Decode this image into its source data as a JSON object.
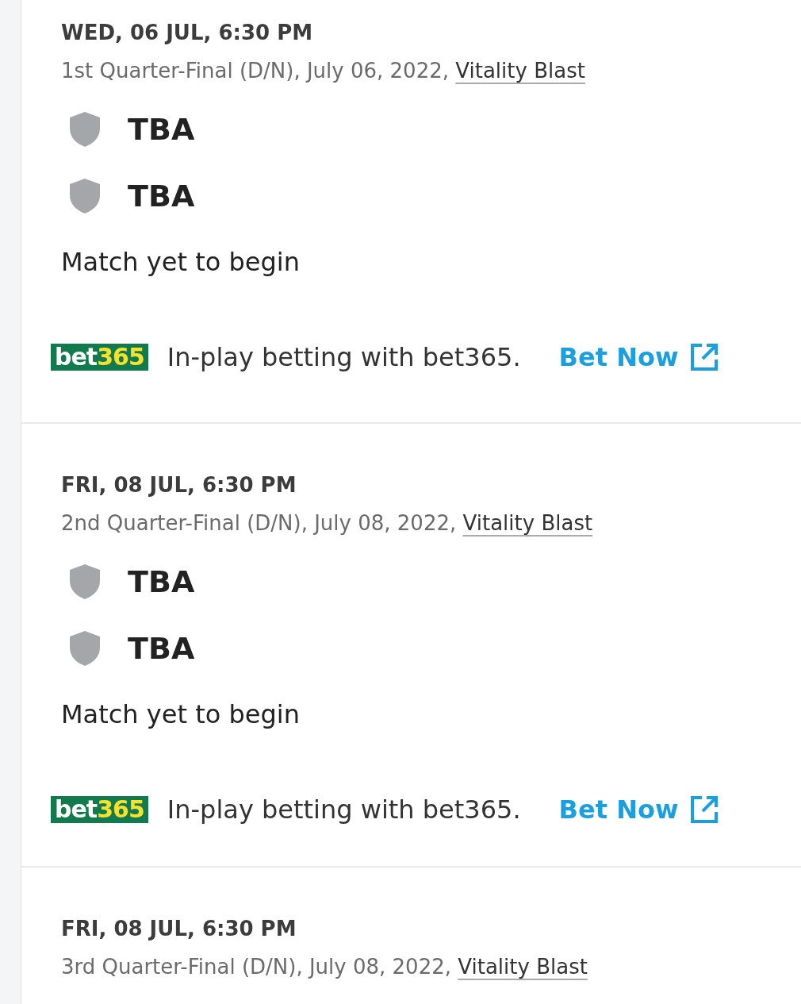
{
  "matches": [
    {
      "date": "WED, 06 JUL, 6:30 PM",
      "description": "1st Quarter-Final (D/N), July 06, 2022, ",
      "league": "Vitality Blast",
      "teams": [
        {
          "name": "TBA"
        },
        {
          "name": "TBA"
        }
      ],
      "status": "Match yet to begin",
      "promo": {
        "logo_main": "bet",
        "logo_accent": "365",
        "text": "In-play betting with bet365.",
        "cta": "Bet Now"
      }
    },
    {
      "date": "FRI, 08 JUL, 6:30 PM",
      "description": "2nd Quarter-Final (D/N), July 08, 2022, ",
      "league": "Vitality Blast",
      "teams": [
        {
          "name": "TBA"
        },
        {
          "name": "TBA"
        }
      ],
      "status": "Match yet to begin",
      "promo": {
        "logo_main": "bet",
        "logo_accent": "365",
        "text": "In-play betting with bet365.",
        "cta": "Bet Now"
      }
    },
    {
      "date": "FRI, 08 JUL, 6:30 PM",
      "description": "3rd Quarter-Final (D/N), July 08, 2022, ",
      "league": "Vitality Blast"
    }
  ]
}
